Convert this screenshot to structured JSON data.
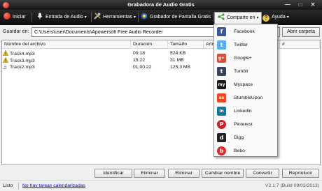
{
  "window": {
    "title": "Grabadora de Audio Gratis",
    "minimize_glyph": "—",
    "maximize_glyph": "□",
    "close_glyph": "✕"
  },
  "toolbar": {
    "start_label": "Iniciar",
    "audio_input_label": "Entrada de Audio",
    "tools_label": "Herramientas",
    "screen_recorder_label": "Grabador de Pantalla Gratis",
    "share_label": "Comparte en",
    "help_label": "Ayuda",
    "caret": "▾",
    "help_glyph": "?"
  },
  "save": {
    "label": "Guardar en:",
    "path": "C:\\Users\\user\\Documents\\Apowersoft Free Audio Recorder",
    "browse_label": "Abrir carpeta"
  },
  "table": {
    "columns": [
      "Nombre del archivo",
      "Duración",
      "Tamaño",
      "Artis",
      "#"
    ],
    "rows": [
      {
        "name": "Track4.mp3",
        "duration": "00:18",
        "size": "524 KB",
        "icon": "warning-icon"
      },
      {
        "name": "Track3.mp3",
        "duration": "15:22",
        "size": "31 MB",
        "icon": "warning-icon"
      },
      {
        "name": "Track2.mp3",
        "duration": "01:00:22",
        "size": "125,3 MB",
        "icon": "music-note-icon"
      }
    ]
  },
  "note_glyph": "♫",
  "buttons": {
    "identify": "Identificar",
    "delete1": "Eliminar",
    "delete2": "Eliminar",
    "rename": "Cambiar nombre",
    "convert": "Convertir",
    "play": "Reproducir"
  },
  "status": {
    "ready": "Listo",
    "no_tasks": "No hay tareas calendarizadas",
    "version": "V2.1.7 (Build 09/03/2013)"
  },
  "share_menu": {
    "items": [
      {
        "label": "Facebook",
        "color": "#3b5998",
        "glyph": "f"
      },
      {
        "label": "Twitter",
        "color": "#55acee",
        "glyph": "t"
      },
      {
        "label": "Google+",
        "color": "#dd4b39",
        "glyph": "g+"
      },
      {
        "label": "Tumblr",
        "color": "#35465c",
        "glyph": "t"
      },
      {
        "label": "Myspace",
        "color": "#1a1a1a",
        "glyph": "my"
      },
      {
        "label": "StumbleUpon",
        "color": "#eb4924",
        "glyph": "su"
      },
      {
        "label": "LinkedIn",
        "color": "#0e76a8",
        "glyph": "in"
      },
      {
        "label": "Pinterest",
        "color": "#cb2027",
        "glyph": "P"
      },
      {
        "label": "Digg",
        "color": "#222222",
        "glyph": "d"
      },
      {
        "label": "Bebo",
        "color": "#e2262b",
        "glyph": "b"
      }
    ]
  }
}
